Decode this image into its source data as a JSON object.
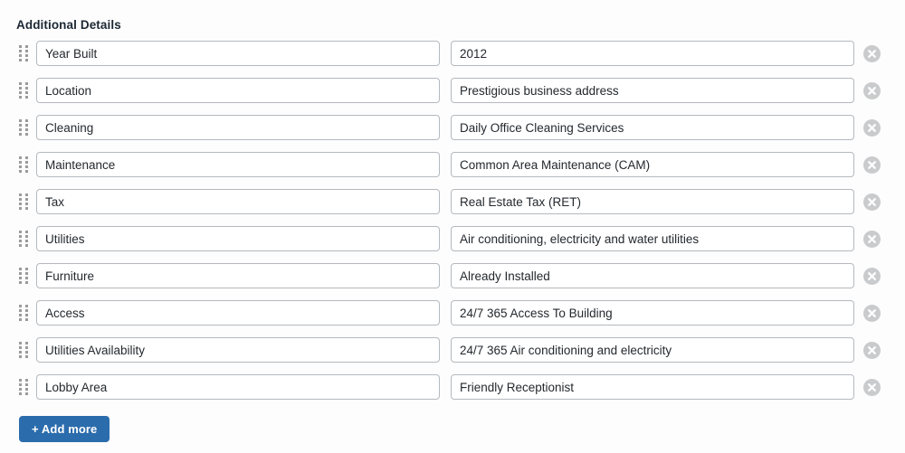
{
  "section": {
    "title": "Additional Details"
  },
  "icons": {
    "drag_handle": "drag-handle-icon",
    "remove": "remove-circle-x-icon",
    "add": "plus-icon"
  },
  "colors": {
    "accent": "#2b6cac",
    "input_border": "#b4b9be",
    "remove_icon": "#c9cbcd",
    "text": "#24292e",
    "heading": "#1b2733",
    "background": "#fdfdfd"
  },
  "fields": {
    "key_placeholder": "Label",
    "value_placeholder": "Value"
  },
  "rows": [
    {
      "key": "Year Built",
      "value": "2012"
    },
    {
      "key": "Location",
      "value": "Prestigious business address"
    },
    {
      "key": "Cleaning",
      "value": "Daily Office Cleaning Services"
    },
    {
      "key": "Maintenance",
      "value": "Common Area Maintenance (CAM)"
    },
    {
      "key": "Tax",
      "value": "Real Estate Tax (RET)"
    },
    {
      "key": "Utilities",
      "value": "Air conditioning, electricity and water utilities"
    },
    {
      "key": "Furniture",
      "value": "Already Installed"
    },
    {
      "key": "Access",
      "value": "24/7 365 Access To Building"
    },
    {
      "key": "Utilities Availability",
      "value": "24/7 365 Air conditioning and electricity"
    },
    {
      "key": "Lobby Area",
      "value": "Friendly Receptionist"
    }
  ],
  "buttons": {
    "add_more": "+ Add more"
  }
}
